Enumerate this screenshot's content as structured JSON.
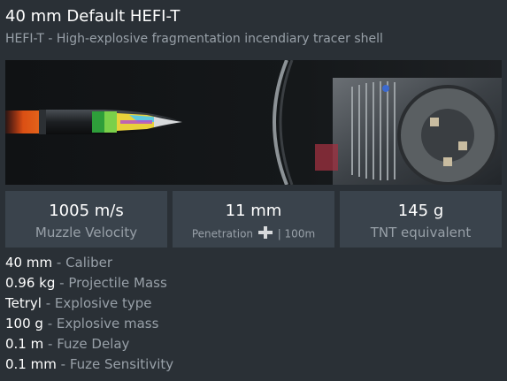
{
  "header": {
    "title": "40 mm Default HEFI-T",
    "subtitle": "HEFI-T - High-explosive fragmentation incendiary tracer shell"
  },
  "stats": [
    {
      "value": "1005 m/s",
      "label": "Muzzle Velocity"
    },
    {
      "value": "11 mm",
      "label_prefix": "Penetration",
      "label_suffix": "| 100m",
      "icon": "penetration-icon"
    },
    {
      "value": "145 g",
      "label": "TNT equivalent"
    }
  ],
  "properties": [
    {
      "value": "40 mm",
      "label": "Caliber"
    },
    {
      "value": "0.96 kg",
      "label": "Projectile Mass"
    },
    {
      "value": "Tetryl",
      "label": "Explosive type"
    },
    {
      "value": "100 g",
      "label": "Explosive mass"
    },
    {
      "value": "0.1 m",
      "label": "Fuze Delay"
    },
    {
      "value": "0.1 mm",
      "label": "Fuze Sensitivity"
    }
  ],
  "separator": "-"
}
